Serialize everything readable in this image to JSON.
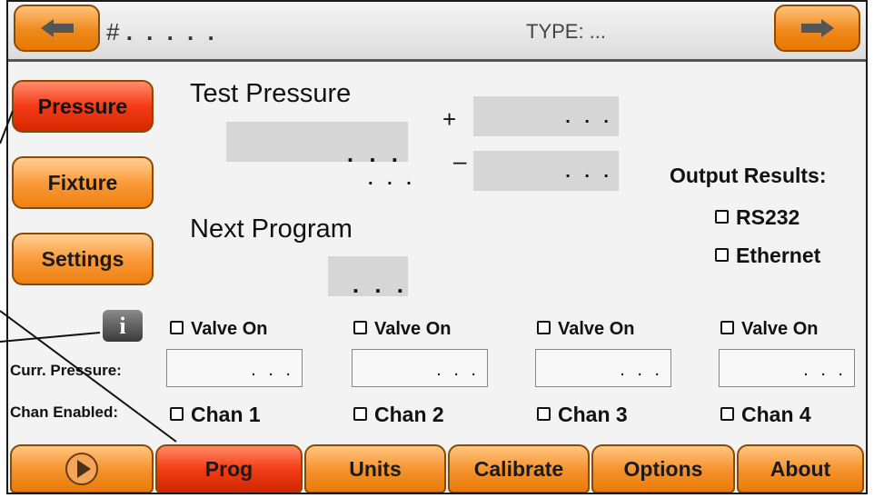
{
  "header": {
    "hash_label": "#",
    "hash_value": ". .   . . .",
    "type_label": "TYPE: ..."
  },
  "sidebar": {
    "pressure": "Pressure",
    "fixture": "Fixture",
    "settings": "Settings"
  },
  "main": {
    "test_pressure_label": "Test Pressure",
    "test_pressure_value": ". . .",
    "test_pressure_unit": ". . .",
    "plus_sign": "+",
    "plus_value": ". . .",
    "minus_sign": "–",
    "minus_value": ". . .",
    "next_program_label": "Next Program",
    "next_program_value": ". . .",
    "output_results_label": "Output Results:",
    "output_rs232": "RS232",
    "output_ethernet": "Ethernet"
  },
  "channels": {
    "valve_label": "Valve On",
    "curr_pressure_label": "Curr. Pressure:",
    "chan_enabled_label": "Chan Enabled:",
    "values": [
      ". . .",
      ". . .",
      ". . .",
      ". . ."
    ],
    "names": [
      "Chan 1",
      "Chan 2",
      "Chan 3",
      "Chan 4"
    ]
  },
  "bottom_tabs": {
    "prog": "Prog",
    "units": "Units",
    "calibrate": "Calibrate",
    "options": "Options",
    "about": "About"
  },
  "colors": {
    "accent_orange": "#f59430",
    "active_red": "#f33c18"
  }
}
